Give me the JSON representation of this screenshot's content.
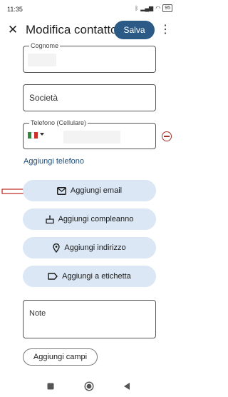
{
  "status_bar": {
    "time": "11:35",
    "battery": "95"
  },
  "app_bar": {
    "title": "Modifica contatto",
    "save_label": "Salva"
  },
  "fields": {
    "surname_label": "Cognome",
    "company_placeholder": "Società",
    "phone_label": "Telefono (Cellulare)"
  },
  "actions": {
    "add_phone": "Aggiungi telefono",
    "add_email": "Aggiungi email",
    "add_birthday": "Aggiungi compleanno",
    "add_address": "Aggiungi indirizzo",
    "add_label": "Aggiungi a etichetta",
    "notes_placeholder": "Note",
    "add_fields": "Aggiungi campi"
  },
  "colors": {
    "accent": "#2b5a86",
    "pill_bg": "#dbe7f4",
    "remove": "#a3322a",
    "annotation": "#c0302a"
  }
}
